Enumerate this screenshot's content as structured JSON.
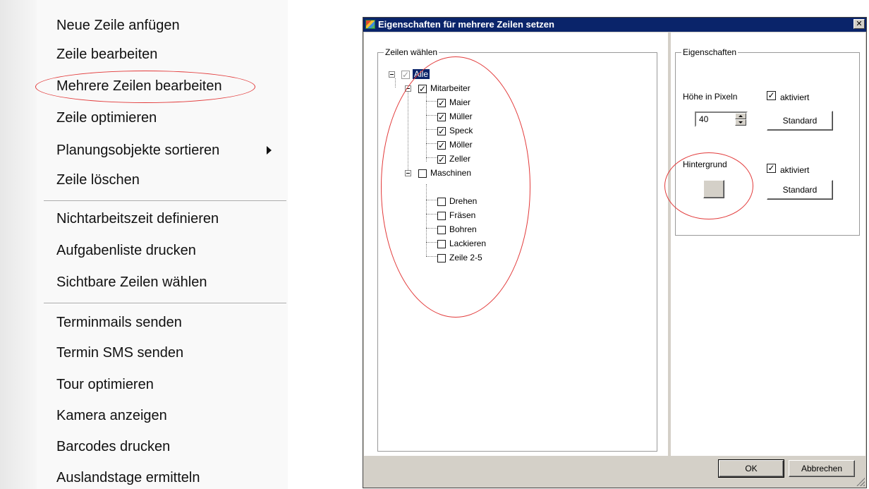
{
  "context_menu": {
    "items": [
      {
        "label": "Neue Zeile anfügen"
      },
      {
        "label": "Zeile bearbeiten"
      },
      {
        "label": "Mehrere Zeilen bearbeiten"
      },
      {
        "label": "Zeile optimieren"
      },
      {
        "label": "Planungsobjekte sortieren",
        "submenu": true
      },
      {
        "label": "Zeile löschen"
      },
      {
        "label": "Nichtarbeitszeit definieren"
      },
      {
        "label": "Aufgabenliste drucken"
      },
      {
        "label": "Sichtbare Zeilen wählen"
      },
      {
        "label": "Terminmails senden"
      },
      {
        "label": "Termin SMS senden"
      },
      {
        "label": "Tour optimieren"
      },
      {
        "label": "Kamera anzeigen"
      },
      {
        "label": "Barcodes drucken"
      },
      {
        "label": "Auslandstage ermitteln"
      }
    ],
    "highlighted_item": "Mehrere Zeilen bearbeiten"
  },
  "dialog": {
    "title": "Eigenschaften für mehrere Zeilen setzen",
    "close_glyph": "✕",
    "tree_group_label": "Zeilen wählen",
    "tree": {
      "root": {
        "label": "Alle",
        "checked": true,
        "selected": true
      },
      "groups": [
        {
          "label": "Mitarbeiter",
          "checked": true,
          "children": [
            {
              "label": "Maier",
              "checked": true
            },
            {
              "label": "Müller",
              "checked": true
            },
            {
              "label": "Speck",
              "checked": true
            },
            {
              "label": "Möller",
              "checked": true
            },
            {
              "label": "Zeller",
              "checked": true
            }
          ]
        },
        {
          "label": "Maschinen",
          "checked": false,
          "children": [
            {
              "label": "Drehen",
              "checked": false
            },
            {
              "label": "Fräsen",
              "checked": false
            },
            {
              "label": "Bohren",
              "checked": false
            },
            {
              "label": "Lackieren",
              "checked": false
            },
            {
              "label": "Zeile 2-5",
              "checked": false
            }
          ]
        }
      ]
    },
    "properties": {
      "group_label": "Eigenschaften",
      "height_label": "Höhe in Pixeln",
      "height_value": "40",
      "height_active_label": "aktiviert",
      "height_active_checked": true,
      "height_default_button": "Standard",
      "background_label": "Hintergrund",
      "background_active_label": "aktiviert",
      "background_active_checked": true,
      "background_default_button": "Standard"
    },
    "ok_button": "OK",
    "cancel_button": "Abbrechen"
  },
  "colors": {
    "titlebar": "#0a246a",
    "annotation": "#e23a3a",
    "dialog_face": "#d4d0c8"
  }
}
